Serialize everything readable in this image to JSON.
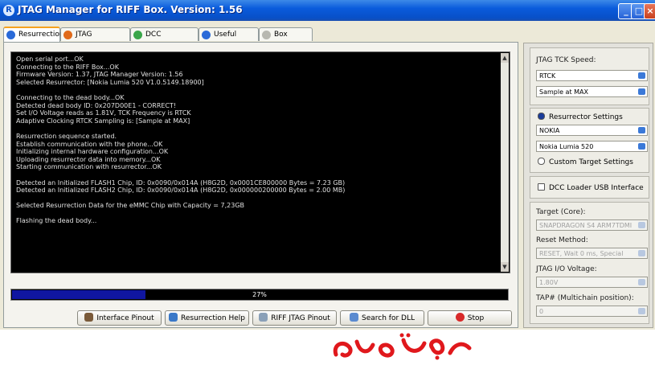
{
  "window": {
    "title": "JTAG Manager for RIFF Box. Version: 1.56"
  },
  "tabs": [
    {
      "label": "Resurrection",
      "active": true,
      "icon": "info-icon"
    },
    {
      "label": "JTAG Read/Write",
      "icon": "chip-icon"
    },
    {
      "label": "DCC Read/Write",
      "icon": "dcc-icon"
    },
    {
      "label": "Useful Plugins",
      "icon": "info-icon"
    },
    {
      "label": "Box Service",
      "icon": "service-icon"
    }
  ],
  "console": {
    "lines": [
      "Open serial port...OK",
      "Connecting to the RIFF Box...OK",
      "Firmware Version: 1.37, JTAG Manager Version: 1.56",
      "Selected Resurrector: [Nokia Lumia 520 V1.0.5149.18900]",
      "",
      "Connecting to the dead body...OK",
      "Detected dead body ID: 0x207D00E1 - CORRECT!",
      "Set I/O Voltage reads as 1.81V, TCK Frequency is RTCK",
      "Adaptive Clocking RTCK Sampling is: [Sample at MAX]",
      "",
      "Resurrection sequence started.",
      "Establish communication with the phone...OK",
      "Initializing internal hardware configuration...OK",
      "Uploading resurrector data into memory...OK",
      "Starting communication with resurrector...OK",
      "",
      "Detected an Initialized FLASH1 Chip, ID: 0x0090/0x014A (H8G2D, 0x0001CE800000 Bytes = 7.23 GB)",
      "Detected an Initialized FLASH2 Chip, ID: 0x0090/0x014A (H8G2D, 0x000000200000 Bytes = 2.00 MB)",
      "",
      "Selected Resurrection Data for the eMMC Chip with Capacity = 7,23GB",
      "",
      "Flashing the dead body..."
    ]
  },
  "progress": {
    "value": 27,
    "label": "27%"
  },
  "buttons": {
    "interface_pinout": "Interface Pinout",
    "resurrection_help": "Resurrection Help",
    "riff_jtag_pinout": "RIFF JTAG Pinout",
    "search_dll": "Search for DLL",
    "stop": "Stop"
  },
  "right_panel": {
    "tck_speed_label": "JTAG TCK Speed:",
    "tck_speed_value": "RTCK",
    "sample_value": "Sample at MAX",
    "resurrector_settings_label": "Resurrector Settings",
    "brand_value": "NOKIA",
    "model_value": "Nokia Lumia 520",
    "custom_target_label": "Custom Target Settings",
    "dcc_loader_label": "DCC Loader USB Interface",
    "target_core_label": "Target (Core):",
    "target_core_value": "SNAPDRAGON S4 ARM7TDMI",
    "reset_method_label": "Reset Method:",
    "reset_method_value": "RESET, Wait 0 ms, Special",
    "io_voltage_label": "JTAG I/O Voltage:",
    "io_voltage_value": "1.80V",
    "tap_label": "TAP# (Multichain position):",
    "tap_value": "0"
  },
  "colors": {
    "title_bar": "#0a5bdc",
    "progress_fill": "#1016a0",
    "signature": "#e0181c"
  }
}
